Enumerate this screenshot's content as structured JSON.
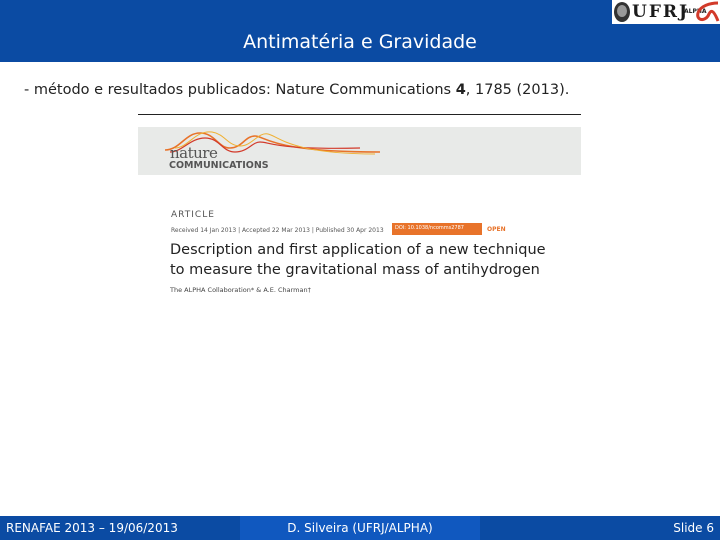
{
  "slide": {
    "title": "Antimatéria e Gravidade",
    "logo_text": "UFRJ",
    "logo_collab": "ALPHA",
    "subtitle_prefix": "- método  e resultados publicados: Nature Communications ",
    "subtitle_volume": "4",
    "subtitle_suffix": ", 1785 (2013)."
  },
  "paper": {
    "journal_word": "nature",
    "journal_sub": "COMMUNICATIONS",
    "article_label": "ARTICLE",
    "dates": "Received 14 Jan 2013 | Accepted 22 Mar 2013 | Published 30 Apr 2013",
    "doi": "DOI: 10.1038/ncomms2787",
    "open_label": "OPEN",
    "title_line1": "Description and first application of a new technique",
    "title_line2": "to measure the gravitational mass of antihydrogen",
    "authors": "The ALPHA Collaboration* & A.E. Charman†"
  },
  "footer": {
    "left": "RENAFAE 2013 – 19/06/2013",
    "center": "D. Silveira (UFRJ/ALPHA)",
    "right": "Slide 6"
  },
  "colors": {
    "title_bar": "#0b4ba3",
    "footer_mid": "#1058bf",
    "accent_orange": "#e8732a",
    "accent_red": "#d23a2a"
  }
}
